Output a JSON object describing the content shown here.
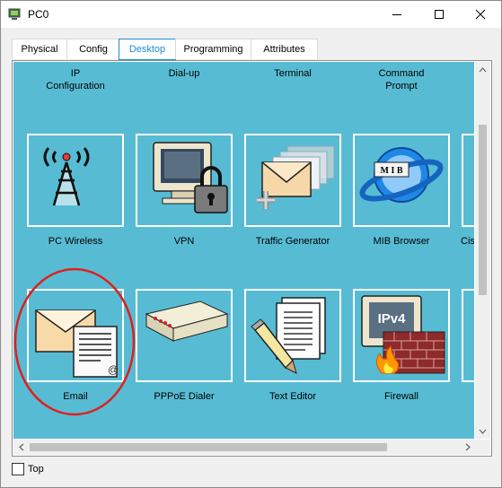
{
  "window": {
    "title": "PC0"
  },
  "tabs": [
    {
      "label": "Physical"
    },
    {
      "label": "Config"
    },
    {
      "label": "Desktop"
    },
    {
      "label": "Programming"
    },
    {
      "label": "Attributes"
    }
  ],
  "active_tab": "Desktop",
  "desktop": {
    "top_labels": [
      {
        "label": "IP\nConfiguration"
      },
      {
        "label": "Dial-up"
      },
      {
        "label": "Terminal"
      },
      {
        "label": "Command\nPrompt"
      }
    ],
    "row1": [
      {
        "label": "PC Wireless",
        "icon": "wireless-antenna-icon"
      },
      {
        "label": "VPN",
        "icon": "vpn-monitor-lock-icon"
      },
      {
        "label": "Traffic Generator",
        "icon": "traffic-generator-envelopes-icon"
      },
      {
        "label": "MIB Browser",
        "icon": "mib-globe-icon"
      },
      {
        "label": "Cisc",
        "icon": "partial-icon"
      }
    ],
    "row2": [
      {
        "label": "Email",
        "icon": "email-envelope-icon"
      },
      {
        "label": "PPPoE Dialer",
        "icon": "pppoe-modem-icon"
      },
      {
        "label": "Text Editor",
        "icon": "text-editor-pencil-icon"
      },
      {
        "label": "Firewall",
        "icon": "ipv4-firewall-icon"
      }
    ],
    "firewall_badge": "IPv4",
    "mib_badge": "M I B",
    "highlight_color": "#e01f1f"
  },
  "footer": {
    "top_checkbox_label": "Top",
    "top_checked": false
  }
}
